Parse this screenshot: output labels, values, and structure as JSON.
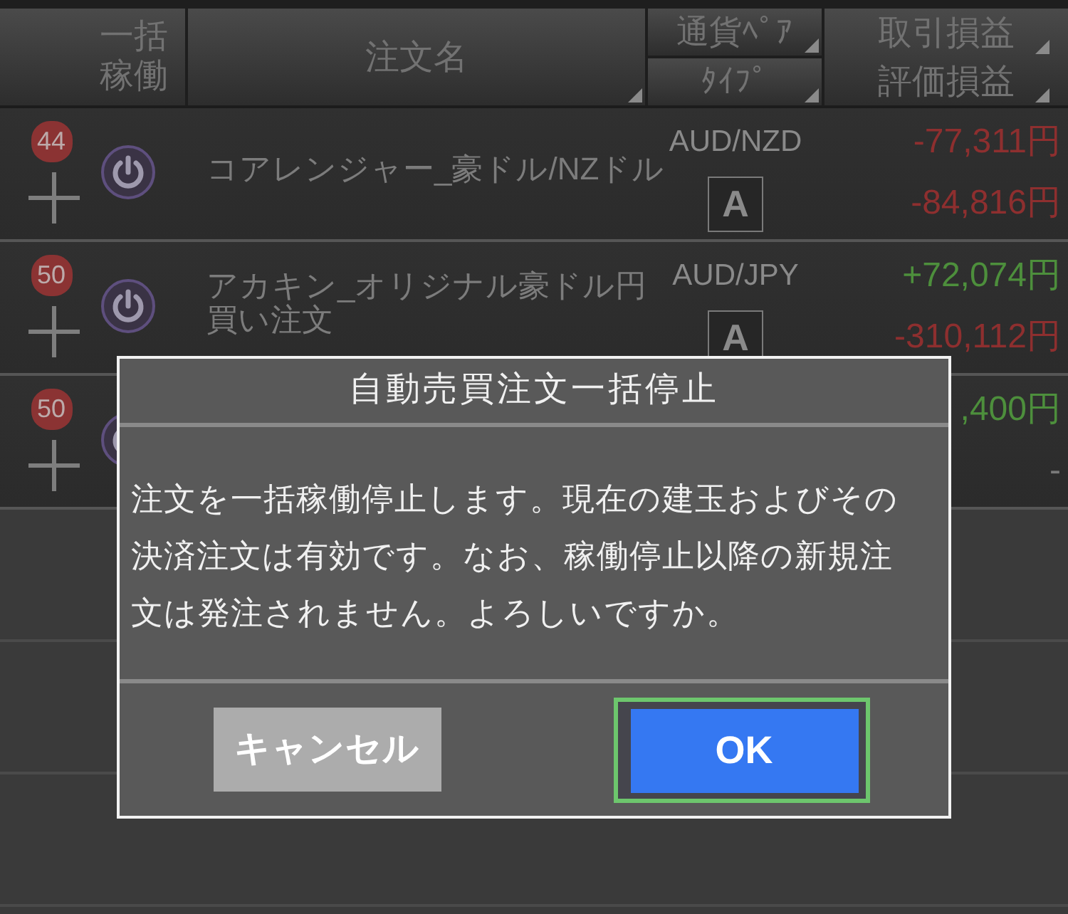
{
  "header": {
    "columns": [
      {
        "kind": "single",
        "label": "一括稼働",
        "sortable": false
      },
      {
        "kind": "single",
        "label": "注文名",
        "sortable": true
      },
      {
        "kind": "split",
        "parts": [
          {
            "label": "通貨ﾍﾟｱ",
            "sortable": true
          },
          {
            "label": "ﾀｲﾌﾟ",
            "sortable": true
          }
        ]
      },
      {
        "kind": "stacked",
        "parts": [
          {
            "label": "取引損益",
            "sortable": true
          },
          {
            "label": "評価損益",
            "sortable": true
          }
        ]
      }
    ]
  },
  "rows": [
    {
      "count": "44",
      "name": "コアレンジャー_豪ドル/NZドル",
      "pair": "AUD/NZD",
      "type": "A",
      "trade_pnl": {
        "text": "-77,311円",
        "color": "#8e2f2f"
      },
      "valuation_pnl": {
        "text": "-84,816円",
        "color": "#8e2f2f"
      }
    },
    {
      "count": "50",
      "name": "アカキン_オリジナル豪ドル円買い注文",
      "pair": "AUD/JPY",
      "type": "A",
      "trade_pnl": {
        "text": "+72,074円",
        "color": "#4d8f3c"
      },
      "valuation_pnl": {
        "text": "-310,112円",
        "color": "#8e2f2f"
      }
    },
    {
      "count": "50",
      "trade_pnl": {
        "text": ",400円",
        "color": "#4d8f3c"
      },
      "valuation_pnl": {
        "text": "-",
        "color": "#7a7a7a"
      }
    }
  ],
  "dialog": {
    "title": "自動売買注文一括停止",
    "message": "注文を一括稼働停止します。現在の建玉およびその決済注文は有効です。なお、稼働停止以降の新規注文は発注されません。よろしいですか。",
    "buttons": [
      {
        "label": "キャンセル",
        "kind": "secondary",
        "focused": false
      },
      {
        "label": "OK",
        "kind": "primary",
        "focused": true
      }
    ]
  }
}
